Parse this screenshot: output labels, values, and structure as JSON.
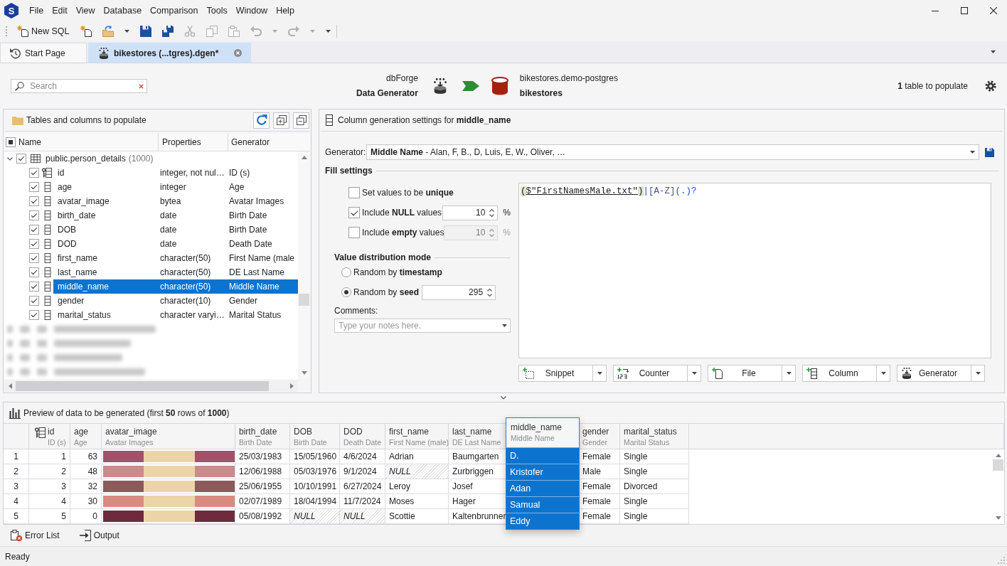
{
  "app": {
    "logo": "S",
    "menu": [
      "File",
      "Edit",
      "View",
      "Database",
      "Comparison",
      "Tools",
      "Window",
      "Help"
    ]
  },
  "toolbar": [
    {
      "label": "New SQL",
      "disabled": false,
      "dropdown": false
    },
    {
      "disabled": false,
      "dropdown": false
    },
    {
      "disabled": false,
      "dropdown": true
    },
    {
      "disabled": false,
      "dropdown": false
    },
    {
      "disabled": false,
      "dropdown": false
    },
    {
      "disabled": true,
      "dropdown": false
    },
    {
      "disabled": true,
      "dropdown": false
    },
    {
      "disabled": true,
      "dropdown": false
    },
    {
      "disabled": true,
      "dropdown": true
    },
    {
      "disabled": true,
      "dropdown": true
    }
  ],
  "tabs": [
    {
      "label": "Start Page",
      "selected": false
    },
    {
      "label": "bikestores (...tgres).dgen*",
      "selected": true
    }
  ],
  "header": {
    "search": {
      "placeholder": "Search"
    },
    "product": {
      "name": "dbForge",
      "title": "Data Generator"
    },
    "target": {
      "connection": "bikestores.demo-postgres",
      "database": "bikestores"
    },
    "summary": "**1** table to populate"
  },
  "tree_panel": {
    "title": "Tables and columns to populate",
    "columns": [
      "Name",
      "Properties",
      "Generator"
    ],
    "header_indeterminate": true,
    "tables": [
      {
        "name": "public.person_details",
        "count": "(1000)",
        "redacted": false,
        "expanded": true,
        "checked": true,
        "children": [
          {
            "name": "id",
            "properties": "integer, not nul…",
            "generator": "ID (s)",
            "checked": true,
            "selected": false,
            "primary_key": true
          },
          {
            "name": "age",
            "properties": "integer",
            "generator": "Age",
            "checked": true,
            "selected": false,
            "primary_key": false
          },
          {
            "name": "avatar_image",
            "properties": "bytea",
            "generator": "Avatar Images",
            "checked": true,
            "selected": false,
            "primary_key": false
          },
          {
            "name": "birth_date",
            "properties": "date",
            "generator": "Birth Date",
            "checked": true,
            "selected": false,
            "primary_key": false
          },
          {
            "name": "DOB",
            "properties": "date",
            "generator": "Birth Date",
            "checked": true,
            "selected": false,
            "primary_key": false
          },
          {
            "name": "DOD",
            "properties": "date",
            "generator": "Death Date",
            "checked": true,
            "selected": false,
            "primary_key": false
          },
          {
            "name": "first_name",
            "properties": "character(50)",
            "generator": "First Name (male",
            "checked": true,
            "selected": false,
            "primary_key": false
          },
          {
            "name": "last_name",
            "properties": "character(50)",
            "generator": "DE Last Name",
            "checked": true,
            "selected": false,
            "primary_key": false
          },
          {
            "name": "middle_name",
            "properties": "character(50)",
            "generator": "Middle Name",
            "checked": true,
            "selected": true,
            "primary_key": false
          },
          {
            "name": "gender",
            "properties": "character(10)",
            "generator": "Gender",
            "checked": true,
            "selected": false,
            "primary_key": false
          },
          {
            "name": "marital_status",
            "properties": "character varyi…",
            "generator": "Marital Status",
            "checked": true,
            "selected": false,
            "primary_key": false
          }
        ]
      },
      {
        "redacted": true
      },
      {
        "redacted": true
      },
      {
        "redacted": true
      },
      {
        "redacted": true
      }
    ]
  },
  "settings": {
    "title": "Column generation settings for **middle_name**",
    "generator_label": "Generator:",
    "generator_value": "**Middle Name** - Alan, F, B., D, Luis, E, W., Oliver, …",
    "fill_title": "Fill settings",
    "options": [
      {
        "label": "Set values to be **unique**",
        "checked": false
      },
      {
        "label": "Include **NULL** values",
        "checked": true,
        "field": {
          "value": "10",
          "unit": "%",
          "disabled": false
        }
      },
      {
        "label": "Include **empty** values",
        "checked": false,
        "field": {
          "value": "10",
          "unit": "%",
          "disabled": true
        }
      }
    ],
    "distribution_title": "Value distribution mode",
    "modes": [
      {
        "label": "Random by **timestamp**",
        "selected": false
      },
      {
        "label": "Random by **seed**",
        "selected": true,
        "field": {
          "value": "295"
        }
      }
    ],
    "comments_label": "Comments:",
    "comments": {
      "placeholder": "Type your notes here."
    },
    "expression": [
      {
        "text": "(",
        "kind": "paren"
      },
      {
        "text": "$\"FirstNamesMale.txt\"",
        "kind": "file"
      },
      {
        "text": ")",
        "kind": "paren"
      },
      {
        "text": "|",
        "kind": "operator"
      },
      {
        "text": "[A-Z]",
        "kind": "class"
      },
      {
        "text": "(.)",
        "kind": "group"
      },
      {
        "text": "?",
        "kind": "operator"
      }
    ],
    "insert_buttons": [
      "Snippet",
      "Counter",
      "File",
      "Column",
      "Generator"
    ]
  },
  "preview": {
    "title": "Preview of data to be generated (first **50** rows of **1000**)",
    "columns": [
      {
        "name": "id",
        "generator": "ID (s)",
        "kind": "number",
        "primary_key": true,
        "selected": false
      },
      {
        "name": "age",
        "generator": "Age",
        "kind": "number",
        "primary_key": false,
        "selected": false
      },
      {
        "name": "avatar_image",
        "generator": "Avatar Images",
        "kind": "image",
        "primary_key": false,
        "selected": false
      },
      {
        "name": "birth_date",
        "generator": "Birth Date",
        "kind": "text",
        "primary_key": false,
        "selected": false
      },
      {
        "name": "DOB",
        "generator": "Birth Date",
        "kind": "text",
        "primary_key": false,
        "selected": false
      },
      {
        "name": "DOD",
        "generator": "Death Date",
        "kind": "text",
        "primary_key": false,
        "selected": false
      },
      {
        "name": "first_name",
        "generator": "First Name (male)",
        "kind": "text",
        "primary_key": false,
        "selected": false
      },
      {
        "name": "last_name",
        "generator": "DE Last Name",
        "kind": "text",
        "primary_key": false,
        "selected": false
      },
      {
        "name": "middle_name",
        "generator": "Middle Name",
        "kind": "text",
        "primary_key": false,
        "selected": true
      },
      {
        "name": "gender",
        "generator": "Gender",
        "kind": "text",
        "primary_key": false,
        "selected": false
      },
      {
        "name": "marital_status",
        "generator": "Marital Status",
        "kind": "text",
        "primary_key": false,
        "selected": false
      }
    ],
    "rows": [
      {
        "number": "1",
        "cells": [
          "1",
          "63",
          {
            "kind": "image"
          },
          "25/03/1983",
          "15/05/1960",
          "4/6/2024",
          "Adrian",
          "Baumgarten",
          "D.",
          "Female",
          "Single"
        ]
      },
      {
        "number": "2",
        "cells": [
          "2",
          "48",
          {
            "kind": "image"
          },
          "12/06/1988",
          "05/03/1976",
          "9/1/2024",
          {
            "text": "NULL",
            "is_null": true
          },
          "Zurbriggen",
          "Kristofer",
          "Male",
          "Single"
        ]
      },
      {
        "number": "3",
        "cells": [
          "3",
          "32",
          {
            "kind": "image"
          },
          "25/06/1955",
          "10/10/1991",
          "6/27/2024",
          "Leroy",
          "Josef",
          "Adan",
          "Female",
          "Divorced"
        ]
      },
      {
        "number": "4",
        "cells": [
          "4",
          "30",
          {
            "kind": "image"
          },
          "02/07/1989",
          "18/04/1994",
          "11/7/2024",
          "Moses",
          "Hager",
          "Samual",
          "Female",
          "Single"
        ]
      },
      {
        "number": "5",
        "cells": [
          "5",
          "0",
          {
            "kind": "image"
          },
          "05/08/1992",
          {
            "text": "NULL",
            "is_null": true
          },
          {
            "text": "NULL",
            "is_null": true
          },
          "Scottie",
          "Kaltenbrunner",
          "Eddy",
          "Female",
          "Single"
        ]
      }
    ]
  },
  "tool_tabs": [
    "Error List",
    "Output"
  ],
  "status_bar": "Ready"
}
